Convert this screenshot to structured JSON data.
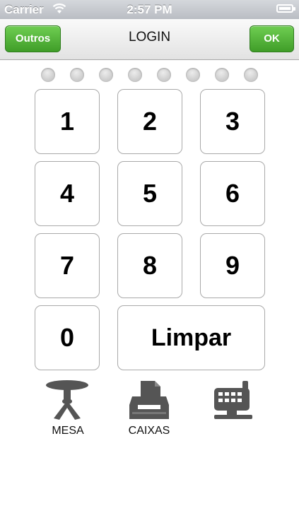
{
  "status_bar": {
    "carrier": "Carrier",
    "time": "2:57 PM",
    "wifi_icon": "wifi-icon",
    "battery_icon": "battery-icon"
  },
  "nav": {
    "title": "LOGIN",
    "left_button": "Outros",
    "right_button": "OK",
    "button_color": "#4caf32"
  },
  "pin_dots_count": 8,
  "keypad": {
    "keys": [
      "1",
      "2",
      "3",
      "4",
      "5",
      "6",
      "7",
      "8",
      "9",
      "0"
    ],
    "clear": "Limpar"
  },
  "actions": [
    {
      "label": "MESA",
      "icon": "table-icon"
    },
    {
      "label": "CAIXAS",
      "icon": "cash-drawer-icon"
    },
    {
      "label": "",
      "icon": "cash-register-icon"
    }
  ]
}
